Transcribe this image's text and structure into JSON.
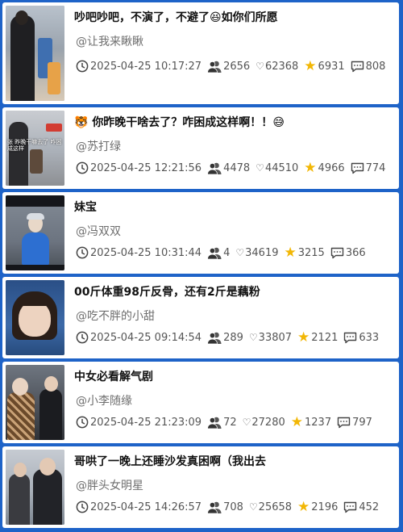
{
  "posts": [
    {
      "title": "吵吧吵吧，不演了，不避了",
      "title_emoji": "😆",
      "title_suffix": "如你们所愿",
      "author": "@让我来瞅瞅",
      "time": "2025-04-25 10:17:27",
      "follow": "2656",
      "likes": "62368",
      "stars": "6931",
      "comments": "808"
    },
    {
      "title_emoji_prefix": "🐯",
      "title": "你昨晚干啥去了？咋困成这样啊！！",
      "title_emoji": "😅",
      "author": "@苏打绿",
      "time": "2025-04-25 12:21:56",
      "follow": "4478",
      "likes": "44510",
      "stars": "4966",
      "comments": "774",
      "thumb_text": "张 昨晚干嘛去了 咋困成这样"
    },
    {
      "title": "妹宝",
      "author": "@冯双双",
      "time": "2025-04-25 10:31:44",
      "follow": "4",
      "likes": "34619",
      "stars": "3215",
      "comments": "366"
    },
    {
      "title": "00斤体重98斤反骨，还有2斤是藕粉",
      "author": "@吃不胖的小甜",
      "time": "2025-04-25 09:14:54",
      "follow": "289",
      "likes": "33807",
      "stars": "2121",
      "comments": "633"
    },
    {
      "title": "中女必看解气剧",
      "author": "@小李随缘",
      "time": "2025-04-25 21:23:09",
      "follow": "72",
      "likes": "27280",
      "stars": "1237",
      "comments": "797"
    },
    {
      "title": "哥哄了一晚上还睡沙发真困啊（我出去",
      "author": "@胖头女明星",
      "time": "2025-04-25 14:26:57",
      "follow": "708",
      "likes": "25658",
      "stars": "2196",
      "comments": "452"
    }
  ],
  "icons": {
    "time": "clock-icon",
    "follow": "users-icon",
    "likes": "heart-icon",
    "stars": "star-icon",
    "comments": "comment-icon"
  },
  "colors": {
    "background": "#1e63c8",
    "card": "#ffffff",
    "star": "#f2b705",
    "meta_text": "#555555",
    "author_text": "#6e6e6e"
  }
}
